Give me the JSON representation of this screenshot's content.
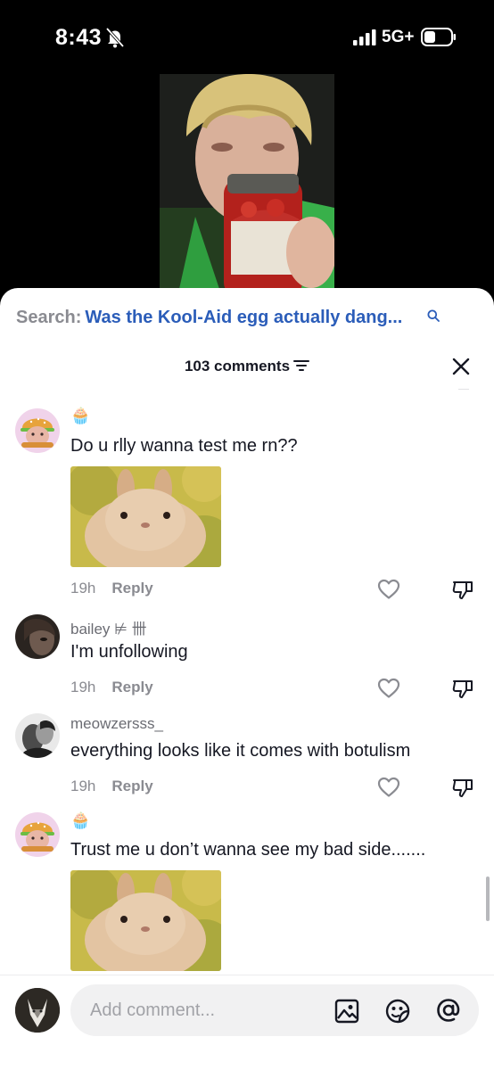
{
  "status_bar": {
    "time": "8:43",
    "network": "5G+",
    "bell_icon": "bell-slash-icon",
    "signal_icon": "cellular-signal-icon",
    "battery_icon": "battery-icon"
  },
  "search": {
    "prefix": "Search:",
    "query": "Was the Kool-Aid egg actually dang...",
    "icon": "search-icon"
  },
  "header": {
    "count_label": "103 comments",
    "filter_icon": "filter-icon",
    "close_icon": "close-icon"
  },
  "comments": [
    {
      "author": "🧁",
      "text": "Do u rlly wanna test me rn??",
      "has_image": true,
      "time": "19h",
      "reply": "Reply",
      "avatar": "burger-avatar"
    },
    {
      "author": "bailey ⊭ 卌",
      "text": "I'm unfollowing",
      "has_image": false,
      "time": "19h",
      "reply": "Reply",
      "avatar": "photo-avatar"
    },
    {
      "author": "meowzersss_",
      "text": "everything looks like it comes with botulism",
      "has_image": false,
      "time": "19h",
      "reply": "Reply",
      "avatar": "bw-photo-avatar"
    },
    {
      "author": "🧁",
      "text": "Trust me u don’t wanna see my bad side.......",
      "has_image": true,
      "time": "",
      "reply": "",
      "avatar": "burger-avatar"
    }
  ],
  "composer": {
    "placeholder": "Add comment...",
    "icons": [
      "image-icon",
      "sticker-icon",
      "mention-icon"
    ]
  },
  "colors": {
    "accent_link": "#2b5db9",
    "text_primary": "#161823",
    "text_secondary": "#8a8b91"
  }
}
